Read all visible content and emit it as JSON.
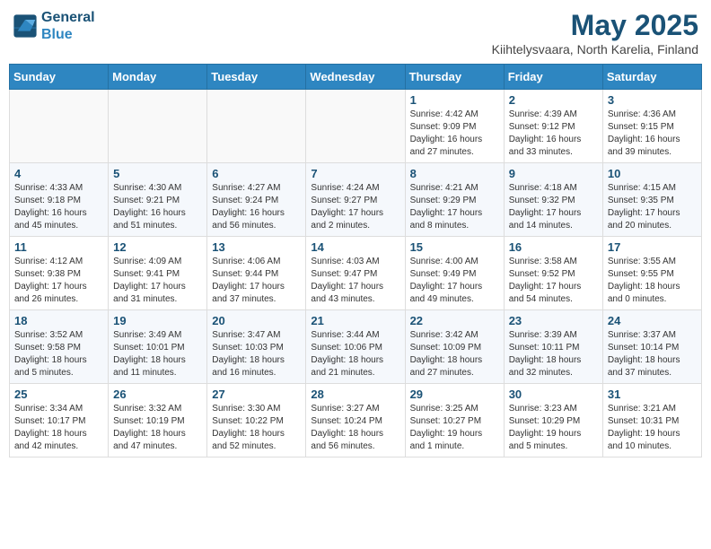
{
  "header": {
    "logo_line1": "General",
    "logo_line2": "Blue",
    "main_title": "May 2025",
    "subtitle": "Kiihtelysvaara, North Karelia, Finland"
  },
  "weekdays": [
    "Sunday",
    "Monday",
    "Tuesday",
    "Wednesday",
    "Thursday",
    "Friday",
    "Saturday"
  ],
  "weeks": [
    [
      {
        "day": "",
        "info": ""
      },
      {
        "day": "",
        "info": ""
      },
      {
        "day": "",
        "info": ""
      },
      {
        "day": "",
        "info": ""
      },
      {
        "day": "1",
        "info": "Sunrise: 4:42 AM\nSunset: 9:09 PM\nDaylight: 16 hours\nand 27 minutes."
      },
      {
        "day": "2",
        "info": "Sunrise: 4:39 AM\nSunset: 9:12 PM\nDaylight: 16 hours\nand 33 minutes."
      },
      {
        "day": "3",
        "info": "Sunrise: 4:36 AM\nSunset: 9:15 PM\nDaylight: 16 hours\nand 39 minutes."
      }
    ],
    [
      {
        "day": "4",
        "info": "Sunrise: 4:33 AM\nSunset: 9:18 PM\nDaylight: 16 hours\nand 45 minutes."
      },
      {
        "day": "5",
        "info": "Sunrise: 4:30 AM\nSunset: 9:21 PM\nDaylight: 16 hours\nand 51 minutes."
      },
      {
        "day": "6",
        "info": "Sunrise: 4:27 AM\nSunset: 9:24 PM\nDaylight: 16 hours\nand 56 minutes."
      },
      {
        "day": "7",
        "info": "Sunrise: 4:24 AM\nSunset: 9:27 PM\nDaylight: 17 hours\nand 2 minutes."
      },
      {
        "day": "8",
        "info": "Sunrise: 4:21 AM\nSunset: 9:29 PM\nDaylight: 17 hours\nand 8 minutes."
      },
      {
        "day": "9",
        "info": "Sunrise: 4:18 AM\nSunset: 9:32 PM\nDaylight: 17 hours\nand 14 minutes."
      },
      {
        "day": "10",
        "info": "Sunrise: 4:15 AM\nSunset: 9:35 PM\nDaylight: 17 hours\nand 20 minutes."
      }
    ],
    [
      {
        "day": "11",
        "info": "Sunrise: 4:12 AM\nSunset: 9:38 PM\nDaylight: 17 hours\nand 26 minutes."
      },
      {
        "day": "12",
        "info": "Sunrise: 4:09 AM\nSunset: 9:41 PM\nDaylight: 17 hours\nand 31 minutes."
      },
      {
        "day": "13",
        "info": "Sunrise: 4:06 AM\nSunset: 9:44 PM\nDaylight: 17 hours\nand 37 minutes."
      },
      {
        "day": "14",
        "info": "Sunrise: 4:03 AM\nSunset: 9:47 PM\nDaylight: 17 hours\nand 43 minutes."
      },
      {
        "day": "15",
        "info": "Sunrise: 4:00 AM\nSunset: 9:49 PM\nDaylight: 17 hours\nand 49 minutes."
      },
      {
        "day": "16",
        "info": "Sunrise: 3:58 AM\nSunset: 9:52 PM\nDaylight: 17 hours\nand 54 minutes."
      },
      {
        "day": "17",
        "info": "Sunrise: 3:55 AM\nSunset: 9:55 PM\nDaylight: 18 hours\nand 0 minutes."
      }
    ],
    [
      {
        "day": "18",
        "info": "Sunrise: 3:52 AM\nSunset: 9:58 PM\nDaylight: 18 hours\nand 5 minutes."
      },
      {
        "day": "19",
        "info": "Sunrise: 3:49 AM\nSunset: 10:01 PM\nDaylight: 18 hours\nand 11 minutes."
      },
      {
        "day": "20",
        "info": "Sunrise: 3:47 AM\nSunset: 10:03 PM\nDaylight: 18 hours\nand 16 minutes."
      },
      {
        "day": "21",
        "info": "Sunrise: 3:44 AM\nSunset: 10:06 PM\nDaylight: 18 hours\nand 21 minutes."
      },
      {
        "day": "22",
        "info": "Sunrise: 3:42 AM\nSunset: 10:09 PM\nDaylight: 18 hours\nand 27 minutes."
      },
      {
        "day": "23",
        "info": "Sunrise: 3:39 AM\nSunset: 10:11 PM\nDaylight: 18 hours\nand 32 minutes."
      },
      {
        "day": "24",
        "info": "Sunrise: 3:37 AM\nSunset: 10:14 PM\nDaylight: 18 hours\nand 37 minutes."
      }
    ],
    [
      {
        "day": "25",
        "info": "Sunrise: 3:34 AM\nSunset: 10:17 PM\nDaylight: 18 hours\nand 42 minutes."
      },
      {
        "day": "26",
        "info": "Sunrise: 3:32 AM\nSunset: 10:19 PM\nDaylight: 18 hours\nand 47 minutes."
      },
      {
        "day": "27",
        "info": "Sunrise: 3:30 AM\nSunset: 10:22 PM\nDaylight: 18 hours\nand 52 minutes."
      },
      {
        "day": "28",
        "info": "Sunrise: 3:27 AM\nSunset: 10:24 PM\nDaylight: 18 hours\nand 56 minutes."
      },
      {
        "day": "29",
        "info": "Sunrise: 3:25 AM\nSunset: 10:27 PM\nDaylight: 19 hours\nand 1 minute."
      },
      {
        "day": "30",
        "info": "Sunrise: 3:23 AM\nSunset: 10:29 PM\nDaylight: 19 hours\nand 5 minutes."
      },
      {
        "day": "31",
        "info": "Sunrise: 3:21 AM\nSunset: 10:31 PM\nDaylight: 19 hours\nand 10 minutes."
      }
    ]
  ]
}
